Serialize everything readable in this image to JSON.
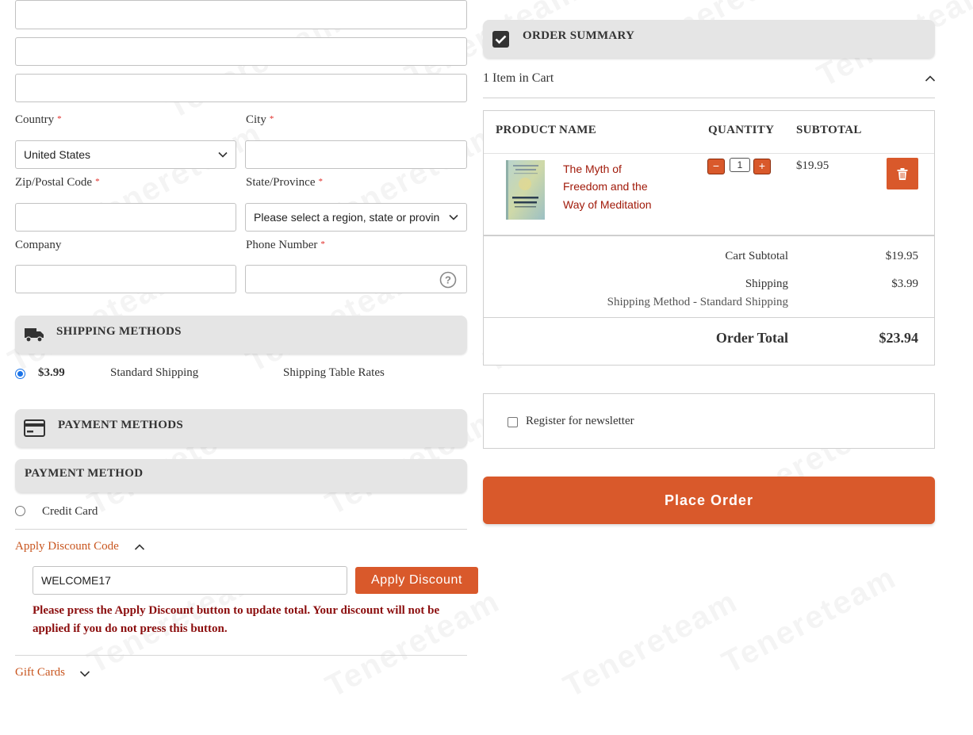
{
  "form": {
    "country_label": "Country",
    "country_value": "United States",
    "city_label": "City",
    "zip_label": "Zip/Postal Code",
    "state_label": "State/Province",
    "state_value": "Please select a region, state or provin",
    "company_label": "Company",
    "phone_label": "Phone Number",
    "required_mark": "*"
  },
  "shipping": {
    "title": "SHIPPING METHODS",
    "price": "$3.99",
    "method": "Standard Shipping",
    "carrier": "Shipping Table Rates"
  },
  "payment": {
    "title": "PAYMENT METHODS",
    "subtitle": "PAYMENT METHOD",
    "option": "Credit Card"
  },
  "discount": {
    "toggle_label": "Apply Discount Code",
    "code_value": "WELCOME17",
    "button_label": "Apply Discount",
    "warning": "Please press the Apply Discount button to update total. Your discount will not be applied if you do not press this button."
  },
  "gift_cards": {
    "label": "Gift Cards"
  },
  "summary": {
    "title": "ORDER SUMMARY",
    "items_in_cart": "1 Item in Cart",
    "col_product": "PRODUCT NAME",
    "col_quantity": "QUANTITY",
    "col_subtotal": "SUBTOTAL",
    "product_line1": "The Myth of",
    "product_line2": "Freedom and the",
    "product_line3": "Way of Meditation",
    "quantity": "1",
    "qty_minus": "−",
    "qty_plus": "+",
    "item_subtotal": "$19.95",
    "cart_subtotal_label": "Cart Subtotal",
    "cart_subtotal_value": "$19.95",
    "shipping_label": "Shipping",
    "shipping_value": "$3.99",
    "shipping_method_label": "Shipping Method - Standard Shipping",
    "order_total_label": "Order Total",
    "order_total_value": "$23.94"
  },
  "newsletter": {
    "label": "Register for newsletter"
  },
  "place_order": {
    "label": "Place Order"
  },
  "watermark": "Tenereteam",
  "colors": {
    "accent": "#d9592b",
    "link": "#c8551e",
    "warning": "#8b0d0d",
    "section_bg": "#e5e5e5"
  }
}
